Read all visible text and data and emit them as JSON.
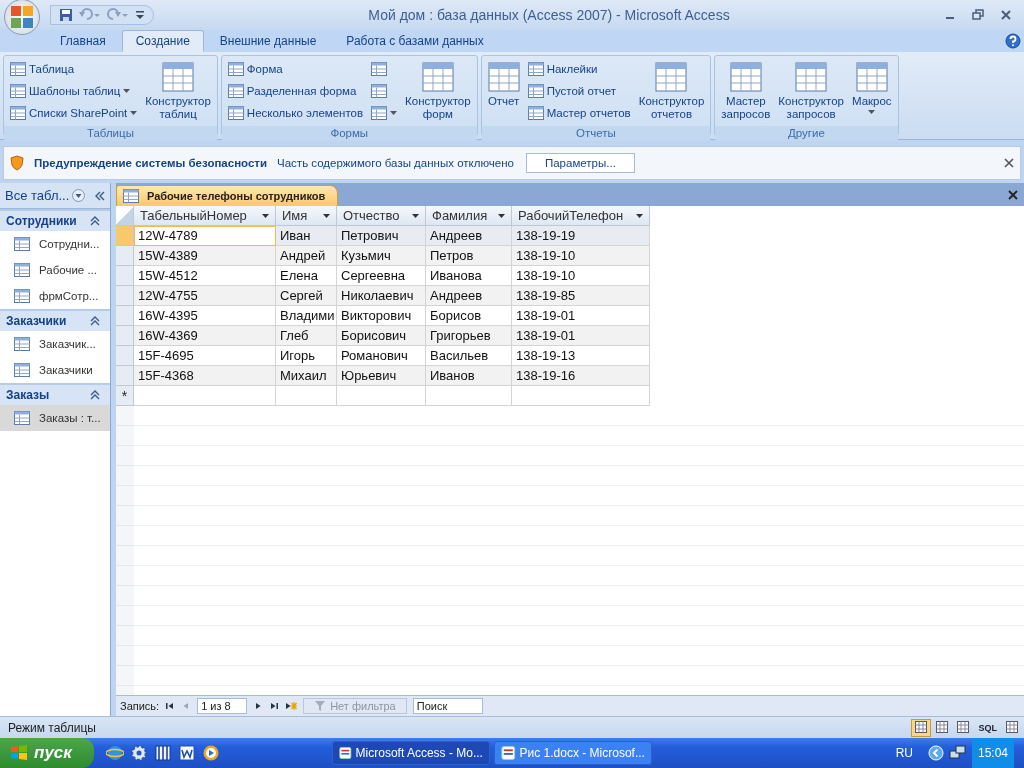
{
  "window": {
    "title": "Мой дом : база данных (Access 2007) - Microsoft Access"
  },
  "ribbon_tabs": [
    {
      "label": "Главная",
      "selected": false
    },
    {
      "label": "Создание",
      "selected": true
    },
    {
      "label": "Внешние данные",
      "selected": false
    },
    {
      "label": "Работа с базами данных",
      "selected": false
    }
  ],
  "ribbon_groups": [
    {
      "title": "Таблицы",
      "columns": [
        {
          "kind": "stack",
          "items": [
            {
              "label": "Таблица",
              "dropdown": false
            },
            {
              "label": "Шаблоны таблиц",
              "dropdown": true
            },
            {
              "label": "Списки SharePoint",
              "dropdown": true
            }
          ]
        },
        {
          "kind": "large",
          "label": "Конструктор таблиц",
          "dropdown": false
        }
      ]
    },
    {
      "title": "Формы",
      "columns": [
        {
          "kind": "stack",
          "items": [
            {
              "label": "Форма",
              "dropdown": false
            },
            {
              "label": "Разделенная форма",
              "dropdown": false
            },
            {
              "label": "Несколько элементов",
              "dropdown": false
            }
          ]
        },
        {
          "kind": "stack",
          "items": [
            {
              "dropdown": false
            },
            {
              "dropdown": false
            },
            {
              "dropdown": true
            }
          ]
        },
        {
          "kind": "large",
          "label": "Конструктор форм",
          "dropdown": false
        }
      ]
    },
    {
      "title": "Отчеты",
      "columns": [
        {
          "kind": "large",
          "label": "Отчет",
          "dropdown": false
        },
        {
          "kind": "stack",
          "items": [
            {
              "label": "Наклейки",
              "dropdown": false
            },
            {
              "label": "Пустой отчет",
              "dropdown": false
            },
            {
              "label": "Мастер отчетов",
              "dropdown": false
            }
          ]
        },
        {
          "kind": "large",
          "label": "Конструктор отчетов",
          "dropdown": false
        }
      ]
    },
    {
      "title": "Другие",
      "columns": [
        {
          "kind": "large",
          "label": "Мастер запросов",
          "dropdown": false
        },
        {
          "kind": "large",
          "label": "Конструктор запросов",
          "dropdown": false
        },
        {
          "kind": "large",
          "label": "Макрос",
          "dropdown": true
        }
      ]
    }
  ],
  "security_bar": {
    "title": "Предупреждение системы безопасности",
    "message": "Часть содержимого базы данных отключено",
    "button": "Параметры..."
  },
  "nav_pane": {
    "filter": "Все табл...",
    "groups": [
      {
        "title": "Сотрудники",
        "items": [
          {
            "label": "Сотрудни...",
            "selected": false
          },
          {
            "label": "Рабочие ...",
            "selected": false
          },
          {
            "label": "фрмСотр...",
            "selected": false
          }
        ]
      },
      {
        "title": "Заказчики",
        "items": [
          {
            "label": "Заказчик...",
            "selected": false
          },
          {
            "label": "Заказчики",
            "selected": false
          }
        ]
      },
      {
        "title": "Заказы",
        "items": [
          {
            "label": "Заказы : т...",
            "selected": true
          }
        ]
      }
    ]
  },
  "document": {
    "tab": "Рабочие телефоны сотрудников",
    "columns": [
      "ТабельныйНомер",
      "Имя",
      "Отчество",
      "Фамилия",
      "РабочийТелефон"
    ],
    "rows": [
      {
        "selected": true,
        "cells": [
          "12W-4789",
          "Иван",
          "Петрович",
          "Андреев",
          "138-19-19"
        ]
      },
      {
        "selected": false,
        "cells": [
          "15W-4389",
          "Андрей",
          "Кузьмич",
          "Петров",
          "138-19-10"
        ]
      },
      {
        "selected": false,
        "cells": [
          "15W-4512",
          "Елена",
          "Сергеевна",
          "Иванова",
          "138-19-10"
        ]
      },
      {
        "selected": false,
        "cells": [
          "12W-4755",
          "Сергей",
          "Николаевич",
          "Андреев",
          "138-19-85"
        ]
      },
      {
        "selected": false,
        "cells": [
          "16W-4395",
          "Владими",
          "Викторович",
          "Борисов",
          "138-19-01"
        ]
      },
      {
        "selected": false,
        "cells": [
          "16W-4369",
          "Глеб",
          "Борисович",
          "Григорьев",
          "138-19-01"
        ]
      },
      {
        "selected": false,
        "cells": [
          "15F-4695",
          "Игорь",
          "Романович",
          "Васильев",
          "138-19-13"
        ]
      },
      {
        "selected": false,
        "cells": [
          "15F-4368",
          "Михаил",
          "Юрьевич",
          "Иванов",
          "138-19-16"
        ]
      }
    ],
    "new_row_marker": "*",
    "record_nav": {
      "label": "Запись:",
      "position": "1 из 8",
      "filter": "Нет фильтра",
      "filter_disabled": true,
      "search_placeholder": "Поиск"
    }
  },
  "status_bar": {
    "text": "Режим таблицы",
    "views": [
      {
        "kind": "icon",
        "selected": true
      },
      {
        "kind": "icon",
        "selected": false
      },
      {
        "kind": "icon",
        "selected": false
      },
      {
        "kind": "text",
        "label": "SQL",
        "selected": false
      },
      {
        "kind": "icon",
        "selected": false
      }
    ]
  },
  "taskbar": {
    "start": "пуск",
    "tasks": [
      {
        "label": "Microsoft Access - Mo...",
        "selected": true
      },
      {
        "label": "Рис 1.docx - Microsof...",
        "selected": false
      }
    ],
    "language": "RU",
    "clock": "15:04"
  }
}
